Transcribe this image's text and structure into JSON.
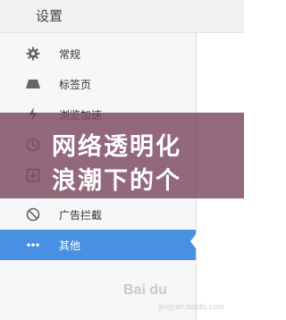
{
  "header": {
    "title": "设置"
  },
  "sidebar": {
    "items": [
      {
        "label": "常规",
        "icon": "gear-icon"
      },
      {
        "label": "标签页",
        "icon": "tab-icon"
      },
      {
        "label": "浏览加速",
        "icon": "lightning-icon"
      },
      {
        "label": "",
        "icon": "clock-icon"
      },
      {
        "label": "",
        "icon": "download-icon"
      },
      {
        "label": "广告拦截",
        "icon": "block-icon"
      },
      {
        "label": "其他",
        "icon": "more-icon",
        "active": true
      }
    ]
  },
  "overlay": {
    "line1": "网络透明化",
    "line2": "浪潮下的个"
  },
  "watermark": {
    "brand": "Bai du",
    "sub": "jingyan.baidu.com"
  },
  "colors": {
    "accent": "#4a90e2",
    "overlay": "#7d4860"
  }
}
